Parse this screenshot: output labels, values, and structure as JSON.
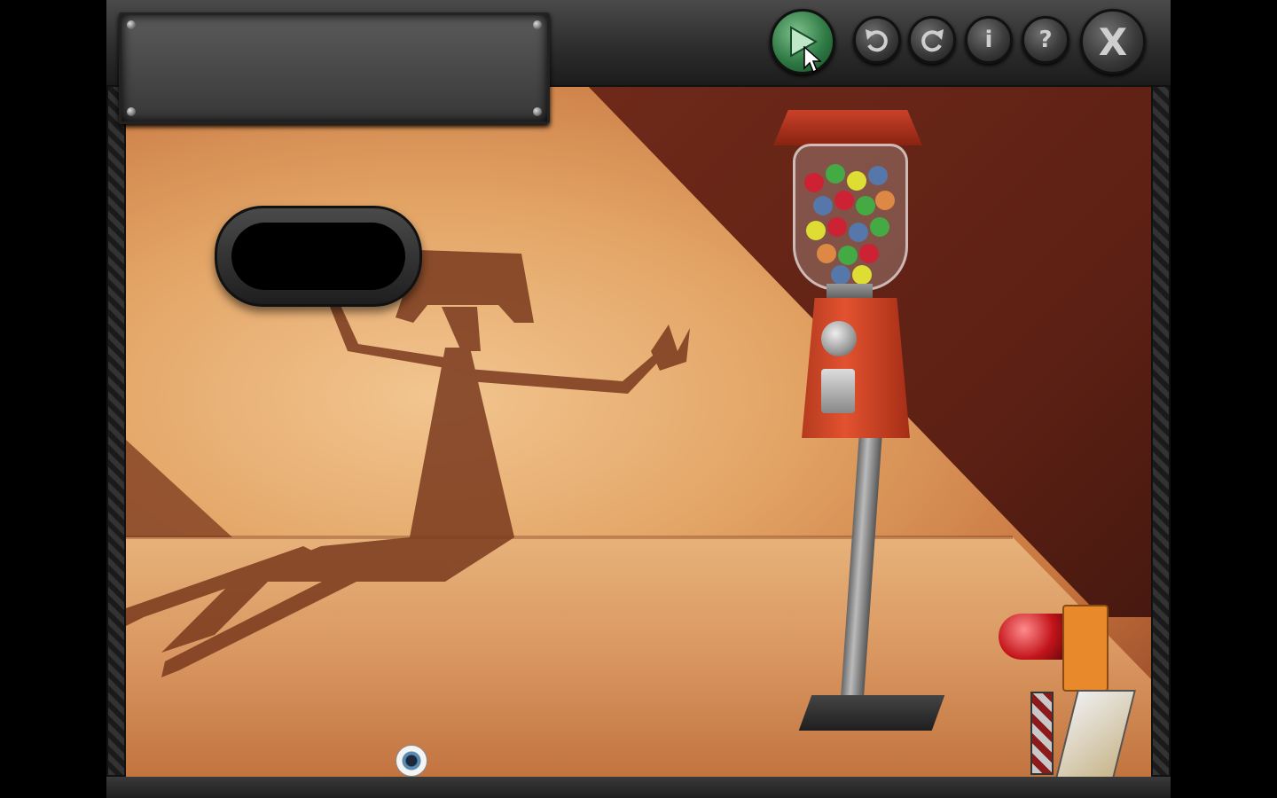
{
  "window": {
    "title": ""
  },
  "toolbar": {
    "play_icon": "play-icon",
    "undo_icon": "undo-icon",
    "redo_icon": "redo-icon",
    "info_label": "i",
    "help_label": "?",
    "close_label": "X"
  },
  "message_plate": {
    "text": ""
  },
  "porthole": {
    "text": ""
  },
  "colors": {
    "play_button": "#2f7a45",
    "gumball_red": "#e2522f",
    "lit_wall": "#f2c590",
    "shadow_wall": "#5c2014",
    "metal_frame": "#2b2b2b"
  },
  "parts_tray": {
    "items": [
      "red-light-part",
      "orange-brick-part",
      "striped-post-part",
      "tile-ramp-part"
    ]
  }
}
